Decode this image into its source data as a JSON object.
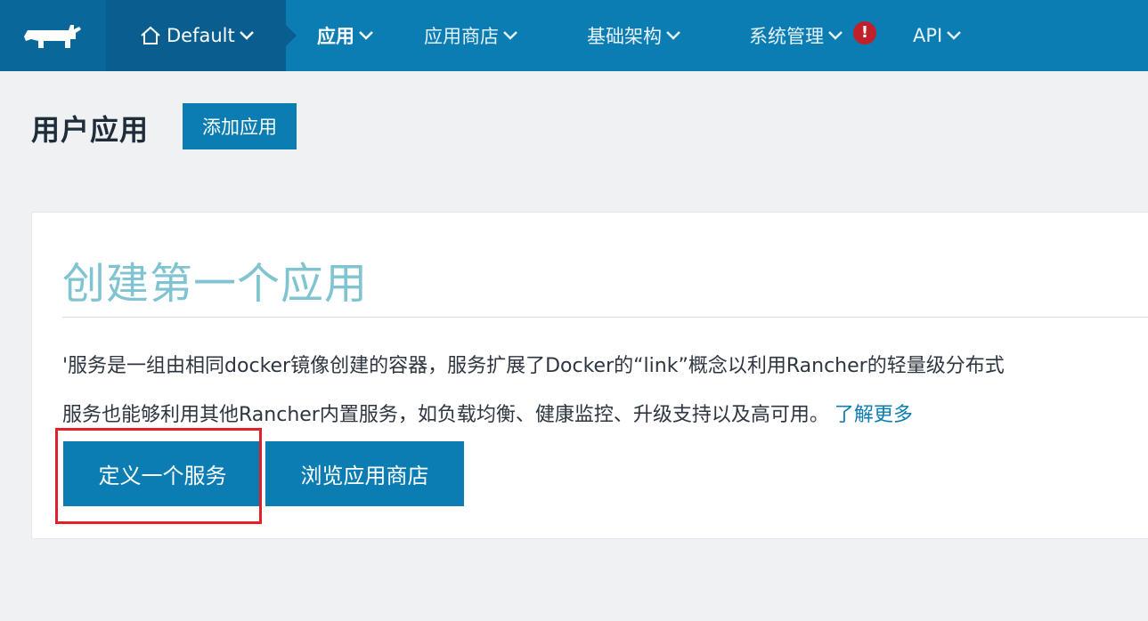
{
  "nav": {
    "env_label": "Default",
    "items": [
      {
        "label": "应用",
        "active": true
      },
      {
        "label": "应用商店",
        "active": false
      },
      {
        "label": "基础架构",
        "active": false
      },
      {
        "label": "系统管理",
        "active": false
      },
      {
        "label": "API",
        "active": false
      }
    ],
    "alert_glyph": "!"
  },
  "header": {
    "title": "用户应用",
    "add_button": "添加应用"
  },
  "card": {
    "title": "创建第一个应用",
    "desc_line1": "'服务是一组由相同docker镜像创建的容器，服务扩展了Docker的“link”概念以利用Rancher的轻量级分布式",
    "desc_line2": "服务也能够利用其他Rancher内置服务，如负载均衡、健康监控、升级支持以及高可用。",
    "learn_more": "了解更多",
    "define_button": "定义一个服务",
    "browse_button": "浏览应用商店"
  },
  "colors": {
    "brand": "#0b7db2",
    "nav_dark": "#095e8f",
    "title_accent": "#7fc4d0",
    "alert": "#c0202a",
    "highlight": "#e0202a"
  },
  "icons": [
    "rancher-logo-icon",
    "home-icon",
    "chevron-down-icon",
    "alert-icon"
  ]
}
